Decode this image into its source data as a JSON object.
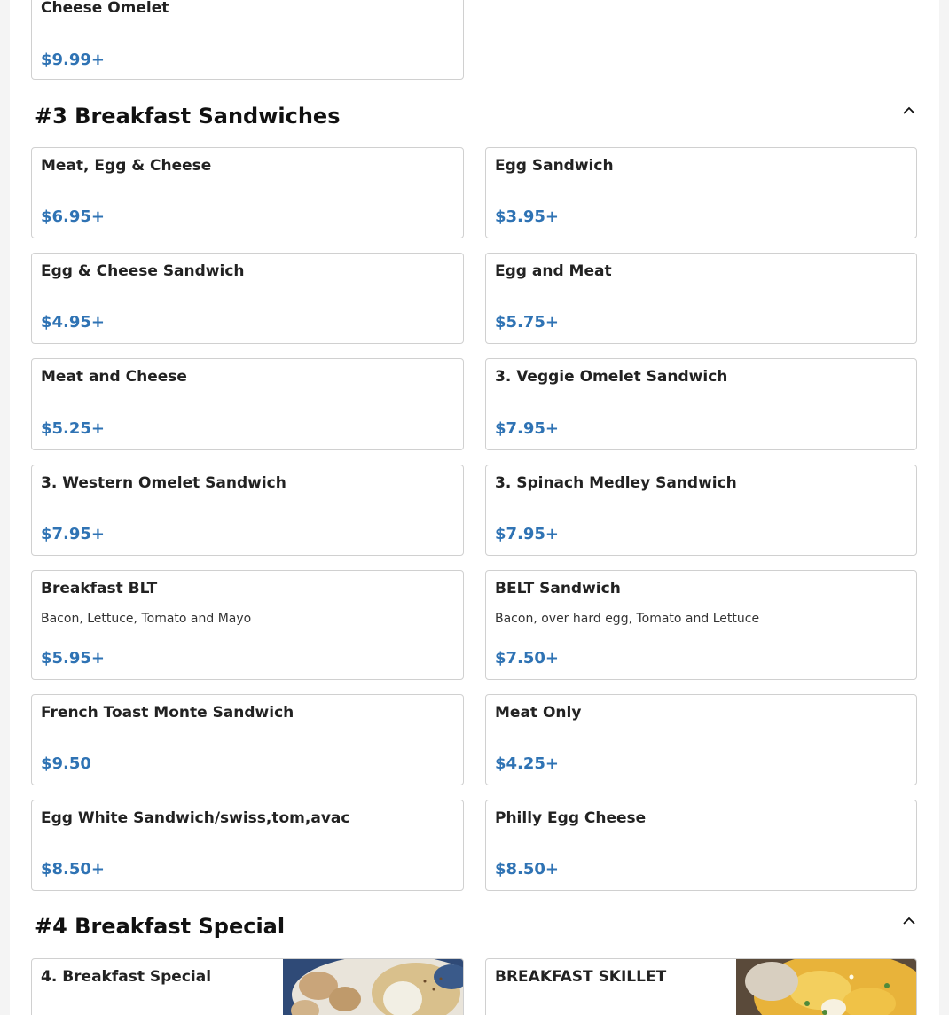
{
  "top_card": {
    "name": "Cheese Omelet",
    "price": "$9.99+"
  },
  "section3": {
    "title": "#3 Breakfast Sandwiches",
    "items": [
      {
        "name": "Meat, Egg & Cheese",
        "price": "$6.95+"
      },
      {
        "name": "Egg Sandwich",
        "price": "$3.95+"
      },
      {
        "name": "Egg & Cheese Sandwich",
        "price": "$4.95+"
      },
      {
        "name": "Egg and Meat",
        "price": "$5.75+"
      },
      {
        "name": "Meat and Cheese",
        "price": "$5.25+"
      },
      {
        "name": "3. Veggie Omelet Sandwich",
        "price": "$7.95+"
      },
      {
        "name": "3. Western Omelet Sandwich",
        "price": "$7.95+"
      },
      {
        "name": "3. Spinach Medley Sandwich",
        "price": "$7.95+"
      },
      {
        "name": "Breakfast BLT",
        "description": "Bacon, Lettuce, Tomato and Mayo",
        "price": "$5.95+"
      },
      {
        "name": "BELT Sandwich",
        "description": "Bacon, over hard egg, Tomato and Lettuce",
        "price": "$7.50+"
      },
      {
        "name": "French Toast Monte Sandwich",
        "price": "$9.50"
      },
      {
        "name": "Meat Only",
        "price": "$4.25+"
      },
      {
        "name": "Egg White Sandwich/swiss,tom,avac",
        "price": "$8.50+"
      },
      {
        "name": "Philly Egg Cheese",
        "price": "$8.50+"
      }
    ]
  },
  "section4": {
    "title": "#4 Breakfast Special",
    "items": [
      {
        "name": "4. Breakfast Special"
      },
      {
        "name": "BREAKFAST SKILLET"
      }
    ]
  },
  "icons": {
    "collapse": "chevron-up-icon"
  },
  "colors": {
    "price": "#2f73b4",
    "border": "#d0d0d0"
  }
}
